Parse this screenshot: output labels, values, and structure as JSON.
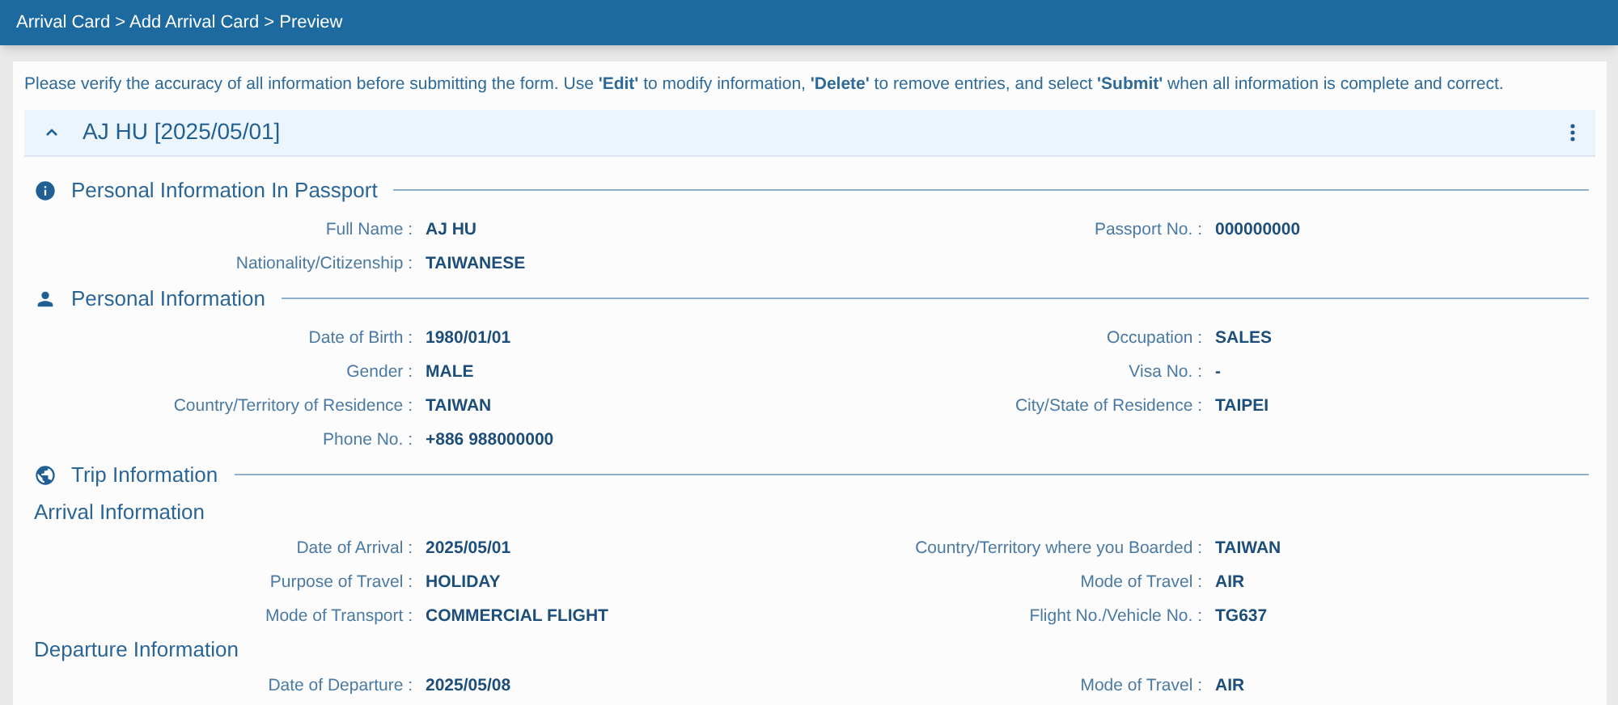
{
  "breadcrumb": "Arrival Card > Add Arrival Card > Preview",
  "notice": "Please verify the accuracy of all information before submitting the form. Use **'Edit'** to modify information, **'Delete'** to remove entries, and select **'Submit'** when all information is complete and correct.",
  "card": {
    "title": "AJ HU [2025/05/01]",
    "expanded": true,
    "sections": [
      {
        "title": "Personal Information In Passport",
        "kind": "info",
        "groups": [
          {
            "rows": [
              {
                "left": {
                  "label": "Full Name :",
                  "value": "AJ HU"
                },
                "right": {
                  "label": "Passport No. :",
                  "value": "000000000"
                }
              },
              {
                "left": {
                  "label": "Nationality/Citizenship :",
                  "value": "TAIWANESE"
                }
              }
            ]
          }
        ]
      },
      {
        "title": "Personal Information",
        "kind": "person",
        "groups": [
          {
            "rows": [
              {
                "left": {
                  "label": "Date of Birth :",
                  "value": "1980/01/01"
                },
                "right": {
                  "label": "Occupation :",
                  "value": "SALES"
                }
              },
              {
                "left": {
                  "label": "Gender :",
                  "value": "MALE"
                },
                "right": {
                  "label": "Visa No. :",
                  "value": "-"
                }
              },
              {
                "left": {
                  "label": "Country/Territory of Residence :",
                  "value": "TAIWAN"
                },
                "right": {
                  "label": "City/State of Residence :",
                  "value": "TAIPEI"
                }
              },
              {
                "left": {
                  "label": "Phone No. :",
                  "value": "+886 988000000"
                }
              }
            ]
          }
        ]
      },
      {
        "title": "Trip Information",
        "kind": "globe",
        "groups": [
          {
            "subtitle": "Arrival Information",
            "rows": [
              {
                "left": {
                  "label": "Date of Arrival :",
                  "value": "2025/05/01"
                },
                "right": {
                  "label": "Country/Territory where you Boarded :",
                  "value": "TAIWAN"
                }
              },
              {
                "left": {
                  "label": "Purpose of Travel :",
                  "value": "HOLIDAY"
                },
                "right": {
                  "label": "Mode of Travel :",
                  "value": "AIR"
                }
              },
              {
                "left": {
                  "label": "Mode of Transport :",
                  "value": "COMMERCIAL FLIGHT"
                },
                "right": {
                  "label": "Flight No./Vehicle No. :",
                  "value": "TG637"
                }
              }
            ]
          },
          {
            "subtitle": "Departure Information",
            "rows": [
              {
                "left": {
                  "label": "Date of Departure :",
                  "value": "2025/05/08"
                },
                "right": {
                  "label": "Mode of Travel :",
                  "value": "AIR"
                }
              }
            ]
          }
        ]
      }
    ]
  }
}
